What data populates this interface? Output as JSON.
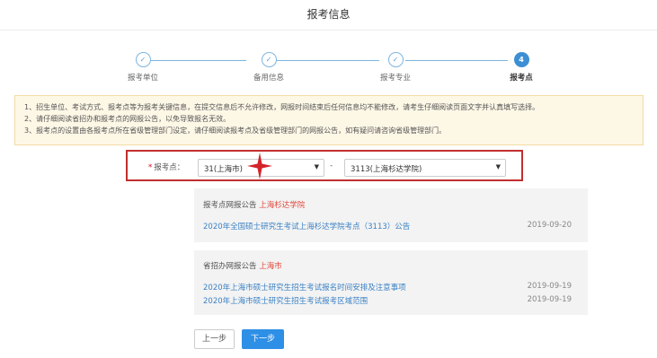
{
  "page": {
    "title": "报考信息"
  },
  "steps": [
    {
      "num": "✓",
      "label": "报考单位",
      "state": "done"
    },
    {
      "num": "✓",
      "label": "备用信息",
      "state": "done"
    },
    {
      "num": "✓",
      "label": "报考专业",
      "state": "done"
    },
    {
      "num": "4",
      "label": "报考点",
      "state": "active"
    }
  ],
  "notice": {
    "lines": [
      "1、招生单位、考试方式、报考点等为报考关键信息，在提交信息后不允许修改，网报时间结束后任何信息均不能修改，请考生仔细阅读页面文字并认真填写选择。",
      "2、请仔细阅读省招办和报考点的网报公告，以免导致报名无效。",
      "3、报考点的设置由各报考点所在省级管理部门设定，请仔细阅读报考点及省级管理部门的网报公告，如有疑问请咨询省级管理部门。"
    ]
  },
  "picker": {
    "required_mark": "*",
    "label": "报考点：",
    "province": "31(上海市)",
    "separator": "-",
    "site": "3113(上海杉达学院)"
  },
  "site_notice": {
    "prefix": "报考点网报公告",
    "name": "上海杉达学院",
    "items": [
      {
        "title": "2020年全国硕士研究生考试上海杉达学院考点（3113）公告",
        "date": "2019-09-20"
      }
    ]
  },
  "province_notice": {
    "prefix": "省招办网报公告",
    "name": "上海市",
    "items": [
      {
        "title": "2020年上海市硕士研究生招生考试报名时间安排及注意事项",
        "date": "2019-09-19"
      },
      {
        "title": "2020年上海市硕士研究生招生考试报考区域范围",
        "date": "2019-09-19"
      }
    ]
  },
  "buttons": {
    "prev": "上一步",
    "next": "下一步"
  },
  "colors": {
    "accent": "#2e8fe6",
    "highlight_box": "#c12f2f",
    "notice_bg": "#fdf7e6",
    "link": "#3b82c4"
  }
}
